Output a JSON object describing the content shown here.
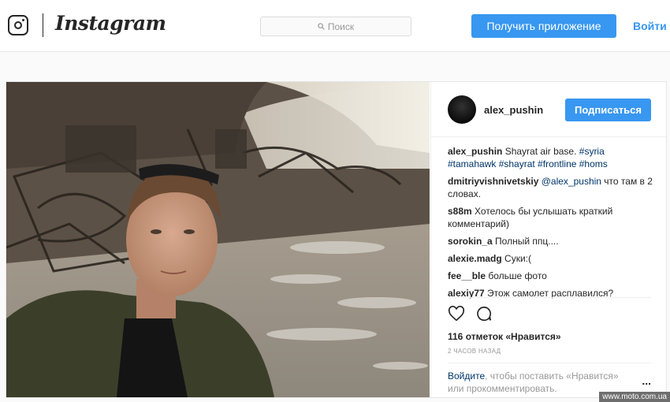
{
  "header": {
    "logo_icon": "instagram-glyph-icon",
    "wordmark": "Instagram",
    "search_placeholder": "Поиск",
    "get_app_label": "Получить приложение",
    "login_label": "Войти"
  },
  "post": {
    "username": "alex_pushin",
    "follow_label": "Подписаться",
    "comments": [
      {
        "user": "alex_pushin",
        "text": "Shayrat air base. ",
        "tags": "#syria #tamahawk #shayrat #frontline #homs"
      },
      {
        "user": "dmitriyvishnivetskiy",
        "mention": "@alex_pushin",
        "text": " что там в 2 словах."
      },
      {
        "user": "s88m",
        "text": " Хотелось бы услышать краткий комментарий)"
      },
      {
        "user": "sorokin_a",
        "text": " Полный ппц...."
      },
      {
        "user": "alexie.madg",
        "text": " Суки:("
      },
      {
        "user": "fee__ble",
        "text": " больше фото"
      },
      {
        "user": "alexiy77",
        "text": " Этож самолет расплавился?"
      }
    ],
    "likes": "116 отметок «Нравится»",
    "time": "2 часов назад",
    "login_link": "Войдите",
    "login_text": ", чтобы поставить «Нравится» или прокомментировать.",
    "more": "..."
  },
  "watermark": "www.moto.com.ua",
  "colors": {
    "accent": "#3897f0",
    "link": "#003569",
    "muted": "#999999"
  }
}
